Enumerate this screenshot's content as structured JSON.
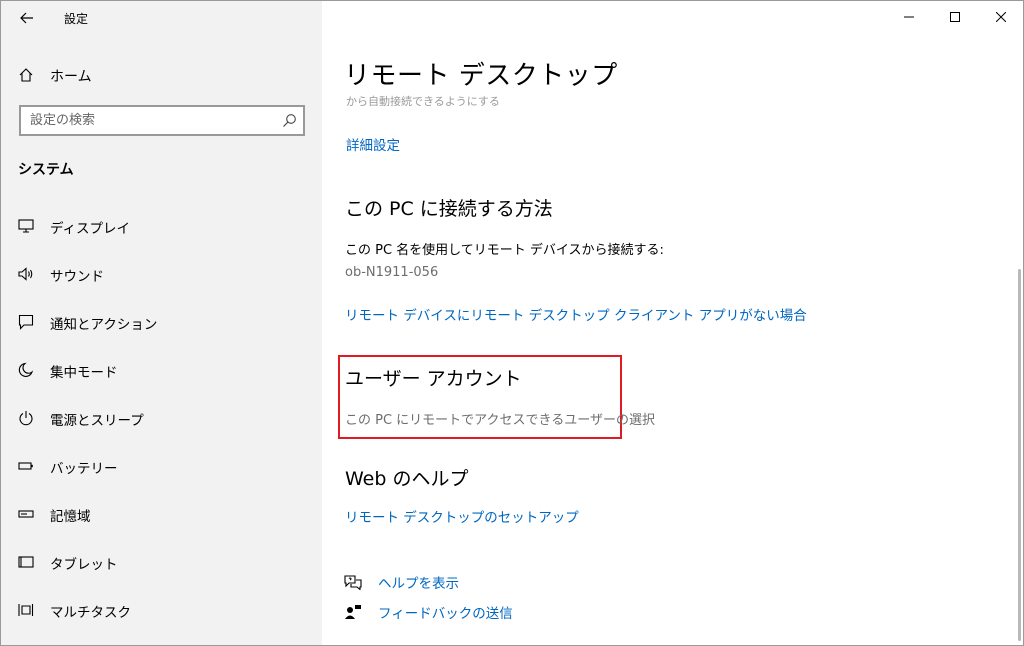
{
  "window": {
    "app_title": "設定",
    "minimize_icon": "minimize-icon",
    "maximize_icon": "maximize-icon",
    "close_icon": "close-icon"
  },
  "sidebar": {
    "home_label": "ホーム",
    "search_placeholder": "設定の検索",
    "section_title": "システム",
    "items": [
      {
        "label": "ディスプレイ",
        "icon": "monitor-icon"
      },
      {
        "label": "サウンド",
        "icon": "speaker-icon"
      },
      {
        "label": "通知とアクション",
        "icon": "notification-icon"
      },
      {
        "label": "集中モード",
        "icon": "moon-icon"
      },
      {
        "label": "電源とスリープ",
        "icon": "power-icon"
      },
      {
        "label": "バッテリー",
        "icon": "battery-icon"
      },
      {
        "label": "記憶域",
        "icon": "storage-icon"
      },
      {
        "label": "タブレット",
        "icon": "tablet-icon"
      },
      {
        "label": "マルチタスク",
        "icon": "multitask-icon"
      }
    ]
  },
  "main": {
    "page_title": "リモート デスクトップ",
    "faded_text": "から自動接続できるようにする",
    "advanced_settings_link": "詳細設定",
    "connect_section": {
      "title": "この PC に接続する方法",
      "description": "この PC 名を使用してリモート デバイスから接続する:",
      "pc_name": "ob-N1911-056",
      "no_client_link": "リモート デバイスにリモート デスクトップ クライアント アプリがない場合"
    },
    "user_accounts": {
      "title": "ユーザー アカウント",
      "select_users": "この PC にリモートでアクセスできるユーザーの選択"
    },
    "web_help": {
      "title": "Web のヘルプ",
      "setup_link": "リモート デスクトップのセットアップ"
    },
    "show_help_link": "ヘルプを表示",
    "feedback_link": "フィードバックの送信"
  },
  "colors": {
    "link": "#0067c0",
    "sidebar_bg": "#f2f2f2",
    "highlight_border": "#e01b24"
  }
}
